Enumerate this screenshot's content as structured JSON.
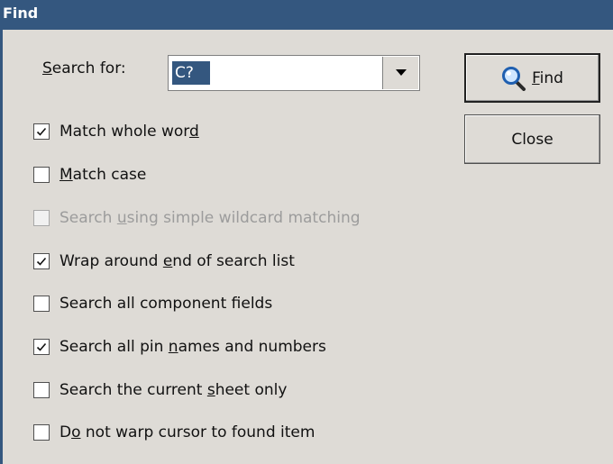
{
  "window": {
    "title": "Find"
  },
  "search": {
    "label_pre": "",
    "label_u": "S",
    "label_post": "earch for:",
    "value": "C?"
  },
  "buttons": {
    "find": {
      "pre": "",
      "u": "F",
      "post": "ind"
    },
    "close": "Close"
  },
  "options": [
    {
      "pre": "Match whole wor",
      "u": "d",
      "post": "",
      "checked": true,
      "enabled": true
    },
    {
      "pre": "",
      "u": "M",
      "post": "atch case",
      "checked": false,
      "enabled": true
    },
    {
      "pre": "Search ",
      "u": "u",
      "post": "sing simple wildcard matching",
      "checked": false,
      "enabled": false
    },
    {
      "pre": "Wrap around ",
      "u": "e",
      "post": "nd of search list",
      "checked": true,
      "enabled": true
    },
    {
      "pre": "Search all component fields",
      "u": "",
      "post": "",
      "checked": false,
      "enabled": true
    },
    {
      "pre": "Search all pin ",
      "u": "n",
      "post": "ames and numbers",
      "checked": true,
      "enabled": true
    },
    {
      "pre": "Search the current ",
      "u": "s",
      "post": "heet only",
      "checked": false,
      "enabled": true
    },
    {
      "pre": "D",
      "u": "o",
      "post": " not warp cursor to found item",
      "checked": false,
      "enabled": true
    }
  ],
  "colors": {
    "titlebar": "#34577f",
    "dialog_bg": "#dedbd6",
    "selection": "#34577f",
    "disabled_text": "#9c9c9c"
  },
  "icons": {
    "find_button": "magnifier-icon",
    "combo_button": "triangle-down-icon",
    "checkmark": "checkmark-icon"
  }
}
